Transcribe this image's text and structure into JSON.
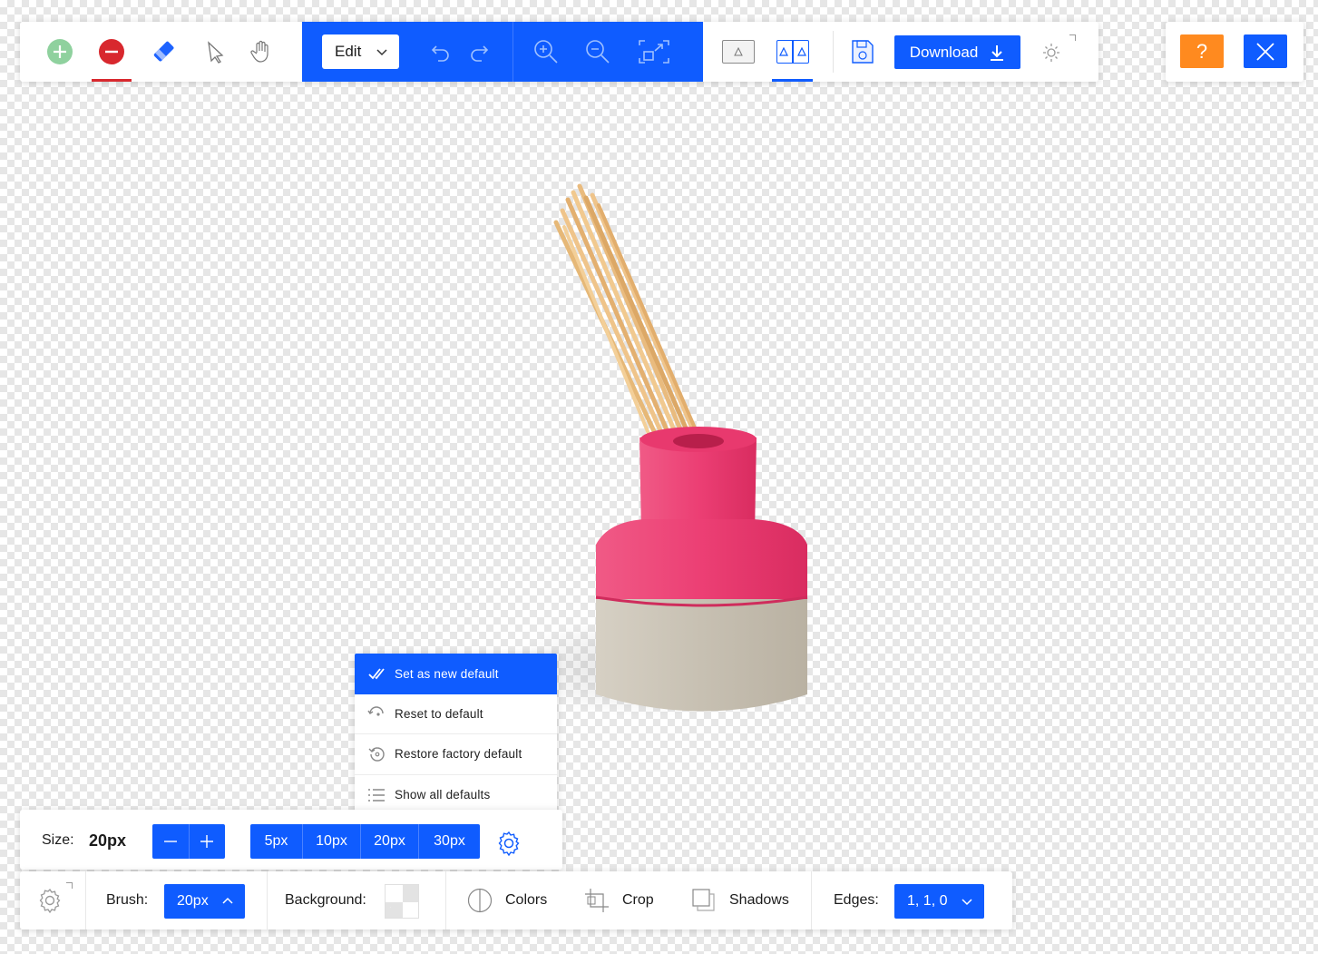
{
  "toolbar": {
    "edit_label": "Edit",
    "download_label": "Download"
  },
  "window_controls": {
    "help_label": "?"
  },
  "context_menu": {
    "items": [
      {
        "label": "Set as new default",
        "icon": "check-icon"
      },
      {
        "label": "Reset to default",
        "icon": "reset-icon"
      },
      {
        "label": "Restore factory default",
        "icon": "restore-icon"
      },
      {
        "label": "Show all defaults",
        "icon": "list-icon"
      }
    ]
  },
  "size_bar": {
    "label": "Size:",
    "value": "20px",
    "presets": [
      "5px",
      "10px",
      "20px",
      "30px"
    ]
  },
  "bottom_toolbar": {
    "brush_label": "Brush:",
    "brush_value": "20px",
    "background_label": "Background:",
    "colors_label": "Colors",
    "crop_label": "Crop",
    "shadows_label": "Shadows",
    "edges_label": "Edges:",
    "edges_value": "1, 1, 0"
  },
  "colors": {
    "accent": "#0f5cff",
    "help": "#ff8a1f",
    "remove": "#d8282e",
    "add": "#8fd19e"
  }
}
